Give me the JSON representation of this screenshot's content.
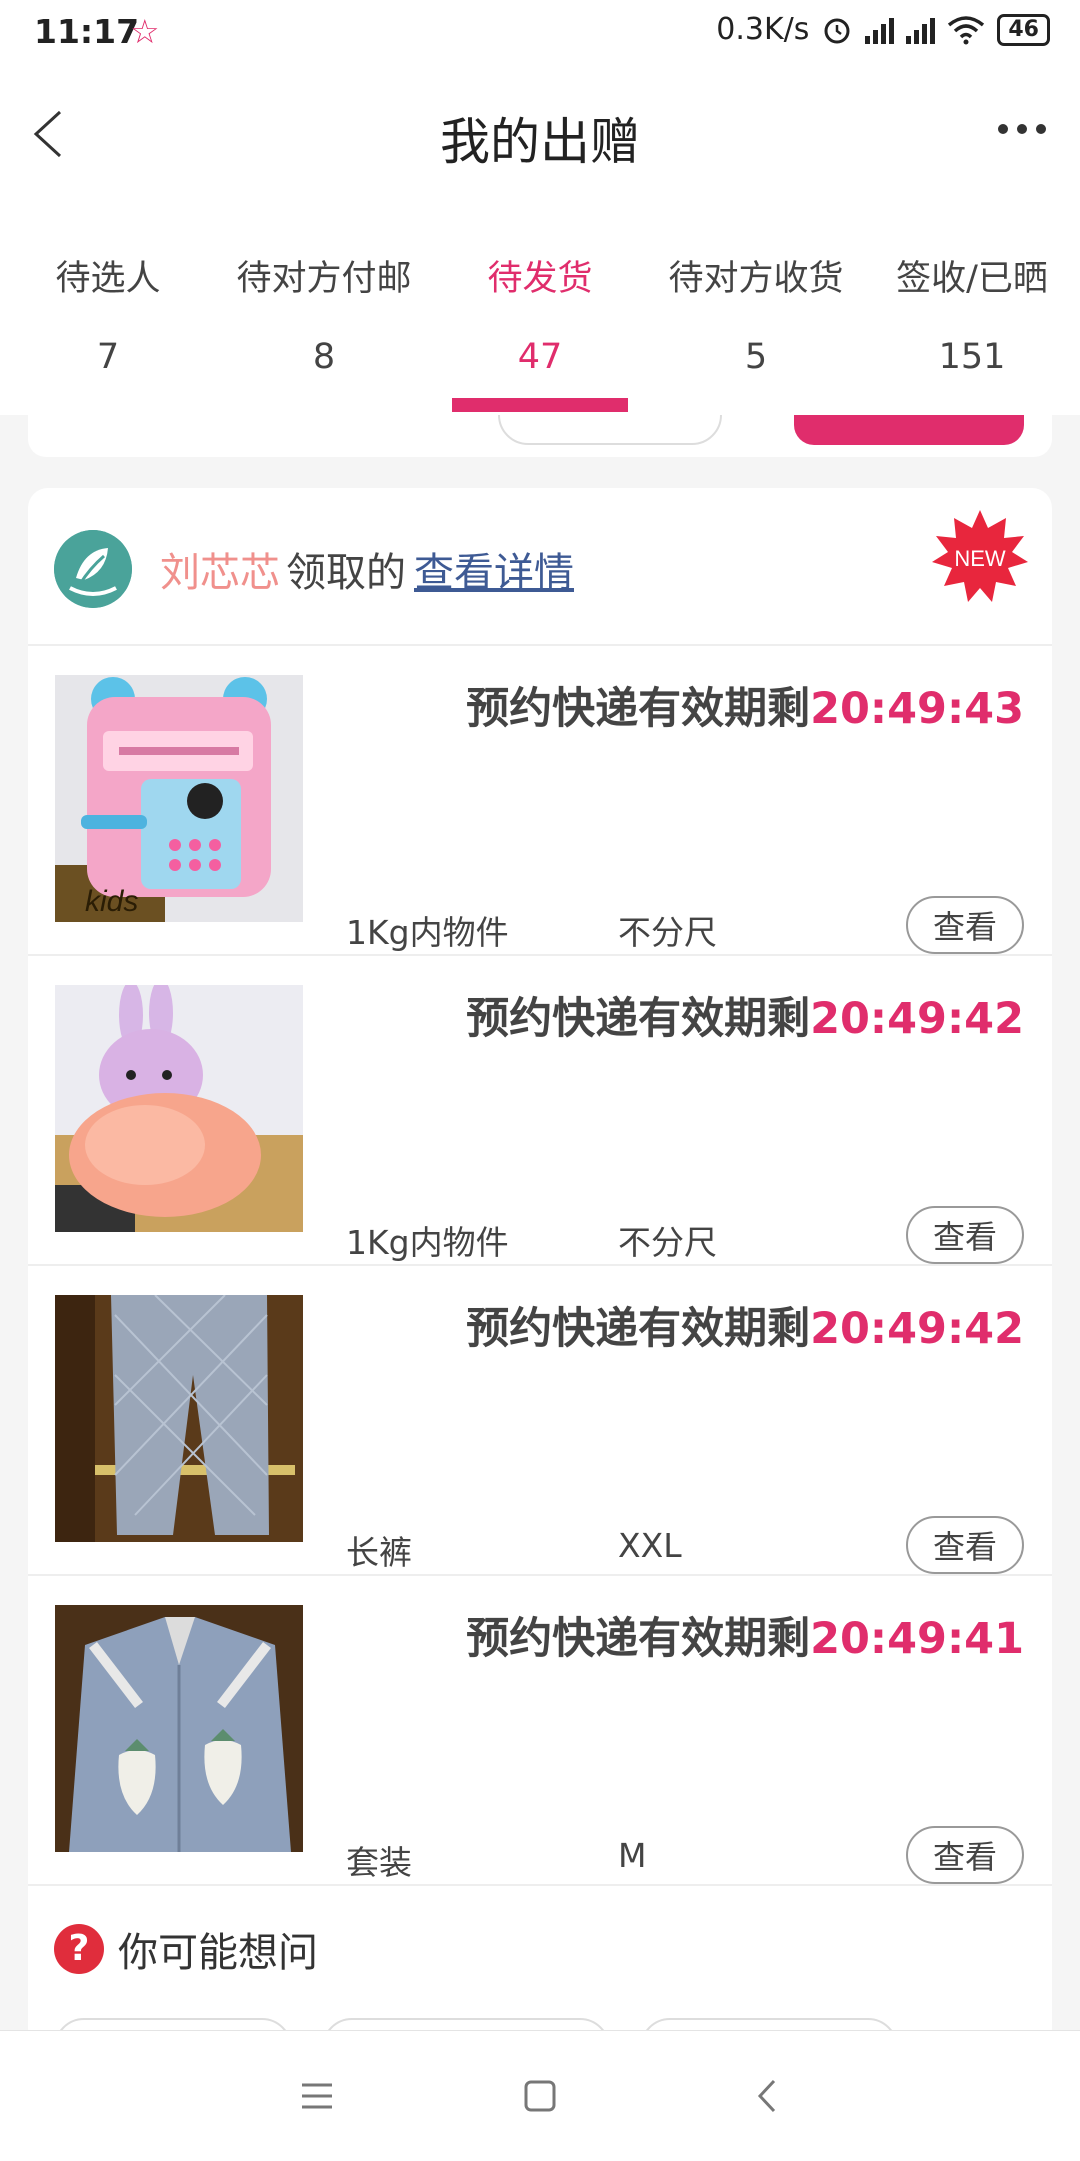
{
  "status_bar": {
    "time": "11:17",
    "network_speed": "0.3K/s",
    "battery": "46"
  },
  "header": {
    "title": "我的出赠"
  },
  "tabs": [
    {
      "label": "待选人",
      "count": "7",
      "active": false
    },
    {
      "label": "待对方付邮",
      "count": "8",
      "active": false
    },
    {
      "label": "待发货",
      "count": "47",
      "active": true
    },
    {
      "label": "待对方收货",
      "count": "5",
      "active": false
    },
    {
      "label": "签收/已晒",
      "count": "151",
      "active": false
    }
  ],
  "order_card": {
    "receiver": "刘芯芯",
    "claimed_text": "领取的",
    "detail_link": "查看详情",
    "badge": "NEW",
    "items": [
      {
        "expire_label": "预约快递有效期剩",
        "time_left": "20:49:43",
        "attr1": "1Kg内物件",
        "attr2": "不分尺",
        "view_label": "查看"
      },
      {
        "expire_label": "预约快递有效期剩",
        "time_left": "20:49:42",
        "attr1": "1Kg内物件",
        "attr2": "不分尺",
        "view_label": "查看"
      },
      {
        "expire_label": "预约快递有效期剩",
        "time_left": "20:49:42",
        "attr1": "长裤",
        "attr2": "XXL",
        "view_label": "查看"
      },
      {
        "expire_label": "预约快递有效期剩",
        "time_left": "20:49:41",
        "attr1": "套装",
        "attr2": "M",
        "view_label": "查看"
      }
    ]
  },
  "faq": {
    "title": "你可能想问"
  },
  "colors": {
    "accent": "#e02d6c",
    "link": "#3e5a94",
    "receiver": "#f0908c"
  }
}
